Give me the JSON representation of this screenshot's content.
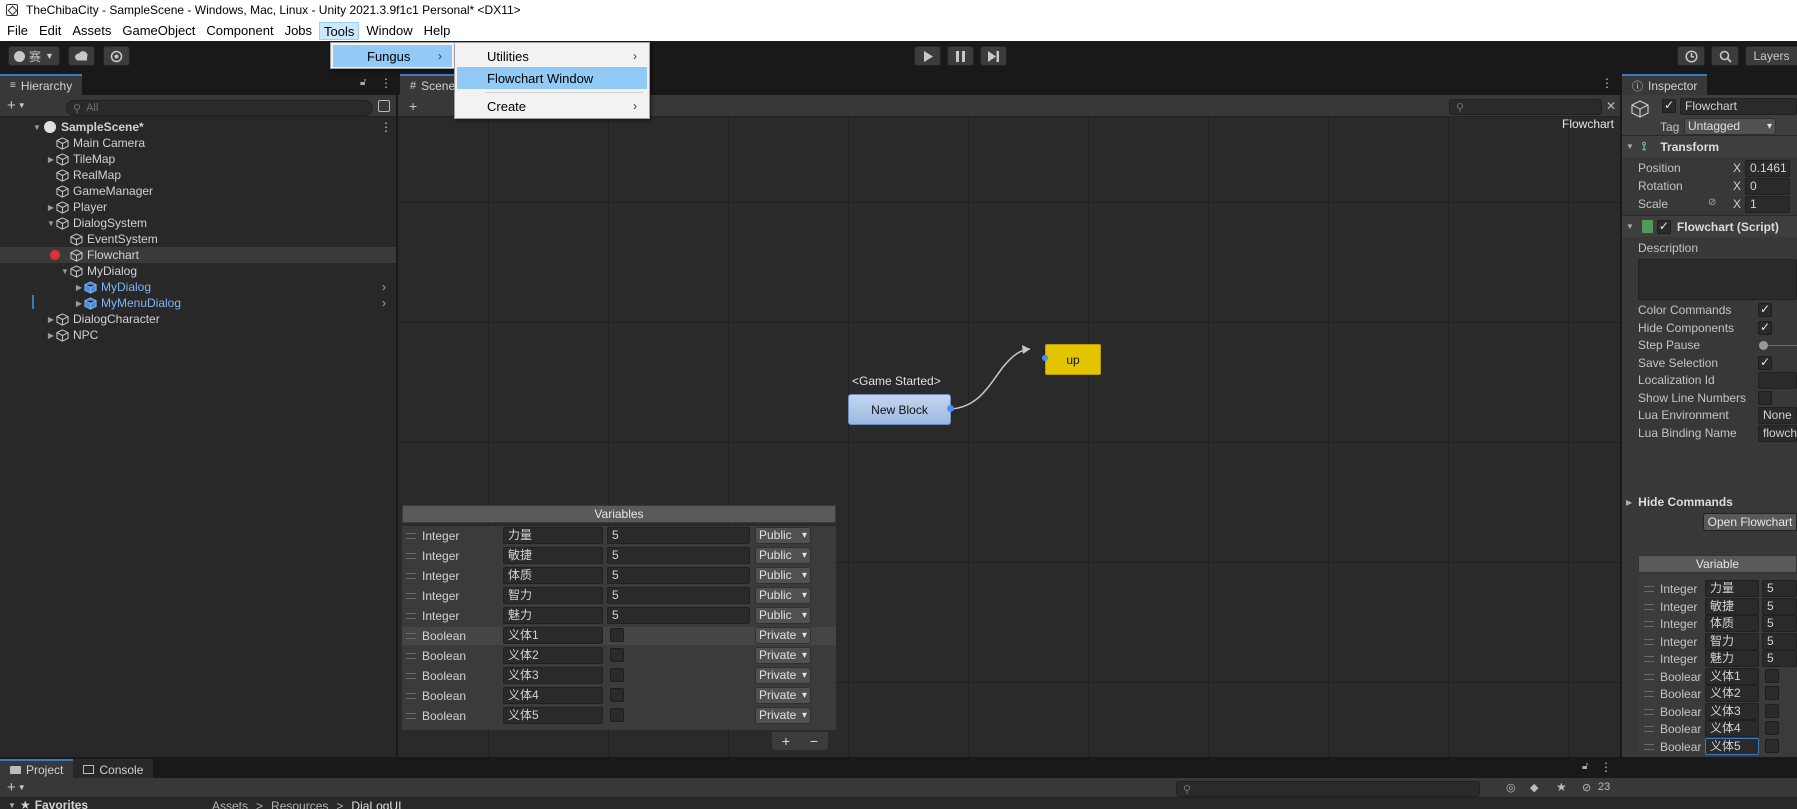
{
  "window": {
    "title": "TheChibaCity - SampleScene - Windows, Mac, Linux - Unity 2021.3.9f1c1 Personal* <DX11>"
  },
  "menubar": {
    "items": [
      "File",
      "Edit",
      "Assets",
      "GameObject",
      "Component",
      "Jobs",
      "Tools",
      "Window",
      "Help"
    ]
  },
  "toolbar": {
    "account_label": "赛",
    "layers_label": "Layers"
  },
  "menus": {
    "tools": {
      "items": [
        "Fungus"
      ]
    },
    "fungus": {
      "items": [
        "Utilities",
        "Flowchart Window",
        "Create"
      ],
      "highlighted": "Flowchart Window"
    }
  },
  "hierarchy": {
    "tab_label": "Hierarchy",
    "search_placeholder": "All",
    "scene_name": "SampleScene*",
    "items": [
      {
        "label": "Main Camera",
        "depth": 1,
        "expandable": false
      },
      {
        "label": "TileMap",
        "depth": 1,
        "expandable": true
      },
      {
        "label": "RealMap",
        "depth": 1,
        "expandable": false
      },
      {
        "label": "GameManager",
        "depth": 1,
        "expandable": false
      },
      {
        "label": "Player",
        "depth": 1,
        "expandable": true
      },
      {
        "label": "DialogSystem",
        "depth": 1,
        "expandable": true
      },
      {
        "label": "EventSystem",
        "depth": 2,
        "expandable": false
      },
      {
        "label": "Flowchart",
        "depth": 2,
        "expandable": false
      },
      {
        "label": "MyDialog",
        "depth": 2,
        "expandable": true
      },
      {
        "label": "MyDialog",
        "depth": 3,
        "expandable": true,
        "prefab": true
      },
      {
        "label": "MyMenuDialog",
        "depth": 3,
        "expandable": true,
        "prefab": true
      },
      {
        "label": "DialogCharacter",
        "depth": 1,
        "expandable": true
      },
      {
        "label": "NPC",
        "depth": 1,
        "expandable": true
      }
    ]
  },
  "scene": {
    "tab_label": "Scene",
    "flowchart_label": "Flowchart",
    "blocks": {
      "start_event": "<Game Started>",
      "new_block": "New Block",
      "up_block": "up"
    }
  },
  "variables": {
    "title": "Variables",
    "rows": [
      {
        "type": "Integer",
        "key": "力量",
        "value": "5",
        "scope": "Public"
      },
      {
        "type": "Integer",
        "key": "敏捷",
        "value": "5",
        "scope": "Public"
      },
      {
        "type": "Integer",
        "key": "体质",
        "value": "5",
        "scope": "Public"
      },
      {
        "type": "Integer",
        "key": "智力",
        "value": "5",
        "scope": "Public"
      },
      {
        "type": "Integer",
        "key": "魅力",
        "value": "5",
        "scope": "Public"
      },
      {
        "type": "Boolean",
        "key": "义体1",
        "value": false,
        "scope": "Private"
      },
      {
        "type": "Boolean",
        "key": "义体2",
        "value": false,
        "scope": "Private"
      },
      {
        "type": "Boolean",
        "key": "义体3",
        "value": false,
        "scope": "Private"
      },
      {
        "type": "Boolean",
        "key": "义体4",
        "value": false,
        "scope": "Private"
      },
      {
        "type": "Boolean",
        "key": "义体5",
        "value": false,
        "scope": "Private"
      }
    ],
    "add": "+",
    "remove": "−"
  },
  "inspector": {
    "tab_label": "Inspector",
    "object_name": "Flowchart",
    "tag_label": "Tag",
    "tag_value": "Untagged",
    "transform": {
      "title": "Transform",
      "position_label": "Position",
      "position_x": "0.1461",
      "rotation_label": "Rotation",
      "rotation_x": "0",
      "scale_label": "Scale",
      "scale_x": "1",
      "x_label": "X"
    },
    "flowchart_script": {
      "title": "Flowchart (Script)",
      "description_label": "Description",
      "fields": [
        {
          "label": "Color Commands",
          "kind": "check",
          "value": true
        },
        {
          "label": "Hide Components",
          "kind": "check",
          "value": true
        },
        {
          "label": "Step Pause",
          "kind": "slider"
        },
        {
          "label": "Save Selection",
          "kind": "check",
          "value": true
        },
        {
          "label": "Localization Id",
          "kind": "text",
          "value": ""
        },
        {
          "label": "Show Line Numbers",
          "kind": "check",
          "value": false
        },
        {
          "label": "Lua Environment",
          "kind": "text",
          "value": "None"
        },
        {
          "label": "Lua Binding Name",
          "kind": "text",
          "value": "flowch"
        }
      ],
      "hide_commands_label": "Hide Commands",
      "open_button": "Open Flowchart",
      "variables_title": "Variable"
    },
    "variables": [
      {
        "type": "Integer",
        "key": "力量",
        "value": "5"
      },
      {
        "type": "Integer",
        "key": "敏捷",
        "value": "5"
      },
      {
        "type": "Integer",
        "key": "体质",
        "value": "5"
      },
      {
        "type": "Integer",
        "key": "智力",
        "value": "5"
      },
      {
        "type": "Integer",
        "key": "魅力",
        "value": "5"
      },
      {
        "type": "Boolear",
        "key": "义体1",
        "value": ""
      },
      {
        "type": "Boolear",
        "key": "义体2",
        "value": ""
      },
      {
        "type": "Boolear",
        "key": "义体3",
        "value": ""
      },
      {
        "type": "Boolear",
        "key": "义体4",
        "value": ""
      },
      {
        "type": "Boolear",
        "key": "义体5",
        "value": ""
      }
    ]
  },
  "bottom": {
    "tabs": [
      "Project",
      "Console"
    ],
    "favorites_label": "Favorites",
    "breadcrumb": [
      "Assets",
      "Resources",
      "DiaLogUI"
    ],
    "hidden_count": "23"
  },
  "colors": {
    "accent": "#3a79bb",
    "selection": "#91c9f7",
    "up_block": "#e3c400",
    "new_block": "#a8c4e6"
  }
}
